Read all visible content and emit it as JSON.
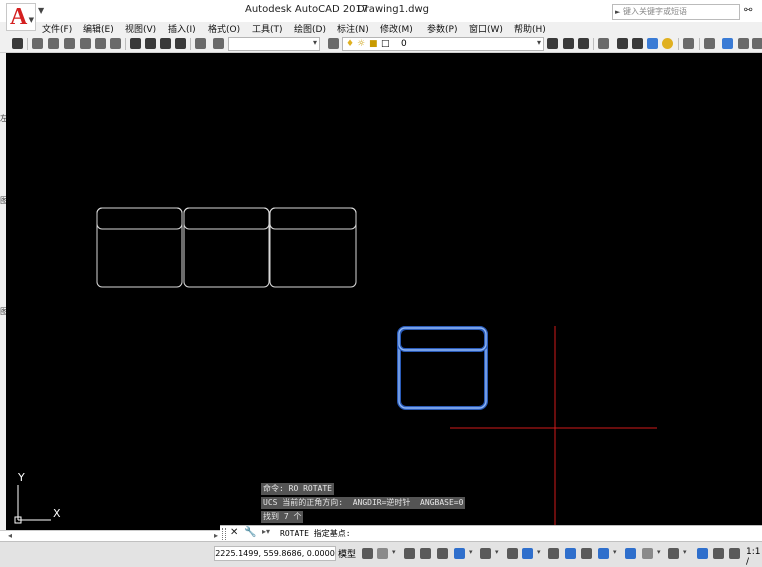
{
  "title_bar": {
    "app_title": "Autodesk AutoCAD 2017",
    "file_name": "Drawing1.dwg",
    "search_placeholder": "键入关键字或短语"
  },
  "menu": {
    "items": [
      "文件(F)",
      "编辑(E)",
      "视图(V)",
      "插入(I)",
      "格式(O)",
      "工具(T)",
      "绘图(D)",
      "标注(N)",
      "修改(M)",
      "参数(P)",
      "窗口(W)",
      "帮助(H)"
    ]
  },
  "layers_toolbar": {
    "current_layer": "0"
  },
  "left_strip_chars": [
    "左",
    "图",
    "图"
  ],
  "command_history": [
    "命令: RO ROTATE",
    "UCS 当前的正角方向:  ANGDIR=逆时针  ANGBASE=0",
    "找到 7 个"
  ],
  "command_prompt": "ROTATE 指定基点:",
  "ucs": {
    "x_label": "X",
    "y_label": "Y"
  },
  "status_bar": {
    "coordinates": "2225.1499, 559.8686, 0.0000",
    "model_label": "模型",
    "annotation_scale": "1:1 /"
  },
  "colors": {
    "canvas_bg": "#000000",
    "drawing_lines": "#d8d8d8",
    "selected_highlight": "#4a86e8",
    "crosshair": "#d01a1a",
    "command_history_bg": "#545454",
    "brand_red": "#d42020"
  }
}
